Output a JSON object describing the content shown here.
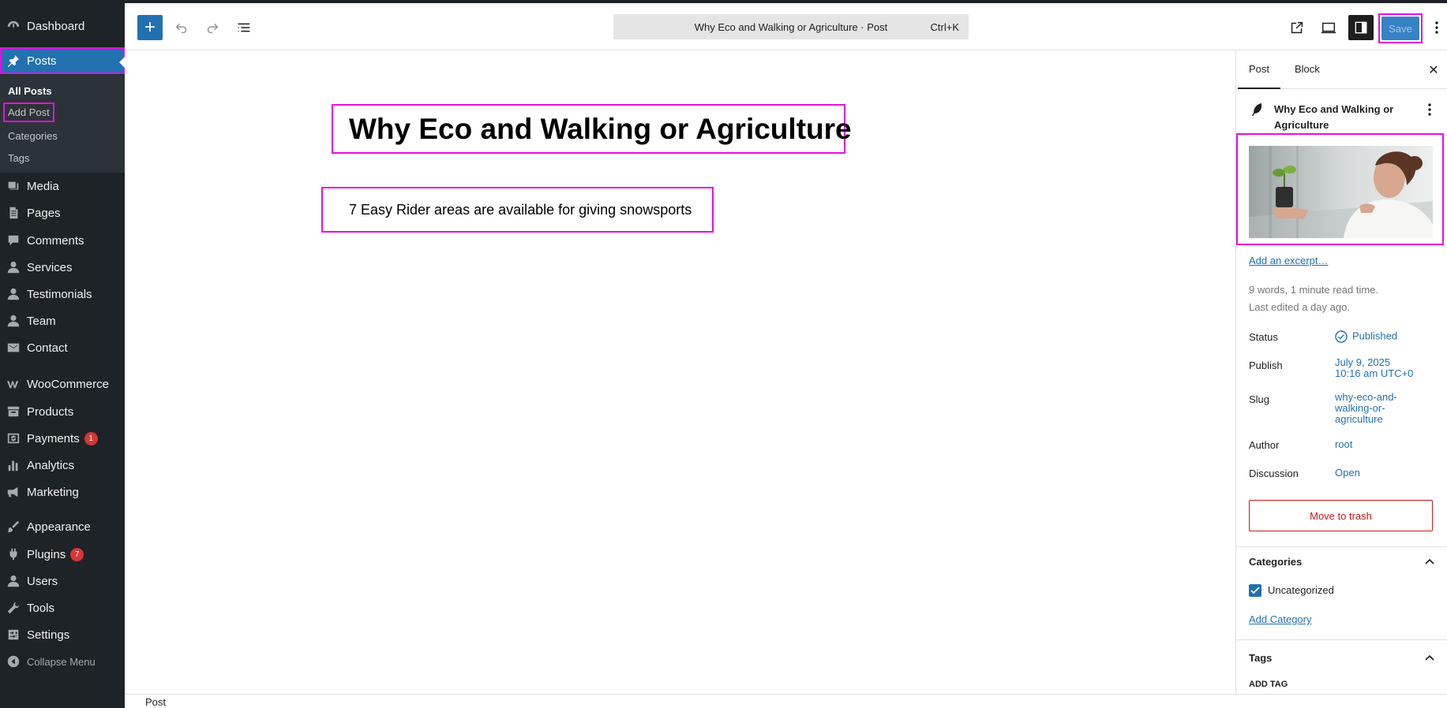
{
  "admin_menu": {
    "items": [
      {
        "label": "Dashboard",
        "icon": "dashboard-icon"
      },
      {
        "label": "Posts",
        "icon": "pin-icon"
      },
      {
        "label": "Media",
        "icon": "media-icon"
      },
      {
        "label": "Pages",
        "icon": "pages-icon"
      },
      {
        "label": "Comments",
        "icon": "comment-icon"
      },
      {
        "label": "Services",
        "icon": "user-icon"
      },
      {
        "label": "Testimonials",
        "icon": "user-icon"
      },
      {
        "label": "Team",
        "icon": "user-icon"
      },
      {
        "label": "Contact",
        "icon": "mail-icon"
      },
      {
        "label": "WooCommerce",
        "icon": "woo-icon"
      },
      {
        "label": "Products",
        "icon": "archive-icon"
      },
      {
        "label": "Payments",
        "icon": "payments-icon",
        "badge": "1"
      },
      {
        "label": "Analytics",
        "icon": "chart-icon"
      },
      {
        "label": "Marketing",
        "icon": "megaphone-icon"
      },
      {
        "label": "Appearance",
        "icon": "brush-icon"
      },
      {
        "label": "Plugins",
        "icon": "plugin-icon",
        "badge": "7"
      },
      {
        "label": "Users",
        "icon": "user-icon"
      },
      {
        "label": "Tools",
        "icon": "wrench-icon"
      },
      {
        "label": "Settings",
        "icon": "settings-icon"
      }
    ],
    "submenu": [
      "All Posts",
      "Add Post",
      "Categories",
      "Tags"
    ],
    "collapse_label": "Collapse Menu"
  },
  "header": {
    "command_bar": "Why Eco and Walking or Agriculture · Post",
    "shortcut": "Ctrl+K",
    "save_label": "Save"
  },
  "editor": {
    "title": "Why Eco and Walking or Agriculture",
    "paragraph": "7 Easy Rider areas are available for giving snowsports"
  },
  "footer": {
    "breadcrumb": "Post"
  },
  "sidebar": {
    "tabs": [
      "Post",
      "Block"
    ],
    "post_title": "Why Eco and Walking or Agriculture",
    "excerpt_link": "Add an excerpt…",
    "word_count": "9 words, 1 minute read time.",
    "last_edited": "Last edited a day ago.",
    "status_label": "Status",
    "status_value": "Published",
    "publish_label": "Publish",
    "publish_date": "July 9, 2025",
    "publish_time": "10:16 am UTC+0",
    "slug_label": "Slug",
    "slug_line1": "why-eco-and-",
    "slug_line2": "walking-or-",
    "slug_line3": "agriculture",
    "author_label": "Author",
    "author_value": "root",
    "discussion_label": "Discussion",
    "discussion_value": "Open",
    "trash_label": "Move to trash",
    "categories_title": "Categories",
    "category_item": "Uncategorized",
    "add_category": "Add Category",
    "tags_title": "Tags",
    "add_tag": "ADD TAG"
  },
  "colors": {
    "accent": "#2271b1",
    "highlight": "#e70ee0",
    "admin_bg": "#1d2327",
    "danger": "#cc1818",
    "badge": "#d63638"
  }
}
